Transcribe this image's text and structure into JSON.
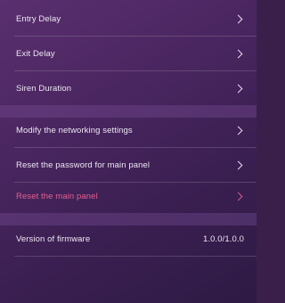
{
  "settings": {
    "entry_delay": "Entry Delay",
    "exit_delay": "Exit Delay",
    "siren_duration": "Siren Duration",
    "modify_networking": "Modify the networking settings",
    "reset_password": "Reset the password for main panel",
    "reset_panel": "Reset the main panel",
    "firmware_label": "Version of firmware",
    "firmware_value": "1.0.0/1.0.0"
  },
  "colors": {
    "accent_danger": "#e3608f",
    "background_top": "#5a2f6f",
    "background_bottom": "#2d1a44"
  },
  "icons": {
    "row_chevron": "chevron-right-icon"
  }
}
